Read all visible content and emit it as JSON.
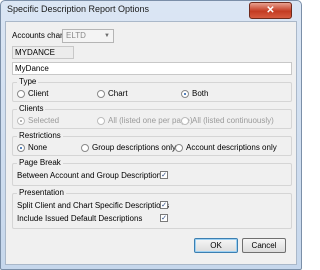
{
  "window": {
    "title": "Specific Description Report Options",
    "close_glyph": "✕"
  },
  "accounts_chart": {
    "label": "Accounts chart:",
    "value": "ELTD",
    "chart_name": "MYDANCE",
    "description": "MyDance"
  },
  "type": {
    "title": "Type",
    "options": [
      {
        "label": "Client",
        "selected": false
      },
      {
        "label": "Chart",
        "selected": false
      },
      {
        "label": "Both",
        "selected": true
      }
    ]
  },
  "clients": {
    "title": "Clients",
    "options": [
      {
        "label": "Selected",
        "selected": true
      },
      {
        "label": "All (listed one per page)",
        "selected": false
      },
      {
        "label": "All (listed continuously)",
        "selected": false
      }
    ]
  },
  "restrictions": {
    "title": "Restrictions",
    "options": [
      {
        "label": "None",
        "selected": true
      },
      {
        "label": "Group descriptions only",
        "selected": false
      },
      {
        "label": "Account descriptions only",
        "selected": false
      }
    ]
  },
  "page_break": {
    "title": "Page Break",
    "between_label": "Between Account and Group Descriptions",
    "between_checked": true
  },
  "presentation": {
    "title": "Presentation",
    "split_label": "Split Client and Chart Specific Descriptions",
    "split_checked": true,
    "issued_label": "Include Issued Default Descriptions",
    "issued_checked": true
  },
  "buttons": {
    "ok": "OK",
    "cancel": "Cancel"
  },
  "checkmark": "✓"
}
